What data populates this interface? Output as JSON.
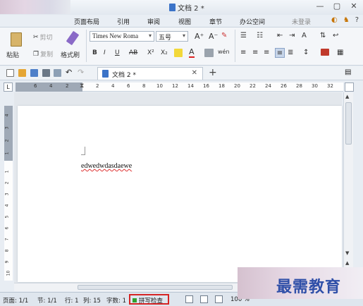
{
  "window": {
    "title": "文档 2 *",
    "controls": [
      "—",
      "▢",
      "✕"
    ]
  },
  "menu_tabs": [
    "页面布局",
    "引用",
    "审阅",
    "视图",
    "章节",
    "办公空间"
  ],
  "account": {
    "login_label": "未登录"
  },
  "ribbon": {
    "paste_label": "粘贴",
    "cut_label": "剪切",
    "copy_label": "复制",
    "format_painter_label": "格式刷",
    "font_name": "Times New Roma",
    "font_size": "五号",
    "bold": "B",
    "italic": "I",
    "underline": "U",
    "strike": "AB",
    "superscript": "X²",
    "subscript": "X₂"
  },
  "document_tab": {
    "label": "文档 2 *",
    "close": "✕",
    "new_tab": "+"
  },
  "ruler": {
    "corner": "L",
    "left_ticks": [
      "6",
      "4",
      "2"
    ],
    "right_ticks": [
      "2",
      "4",
      "6",
      "8",
      "10",
      "12",
      "14",
      "16",
      "18",
      "20",
      "22",
      "24",
      "26",
      "28",
      "30",
      "32"
    ],
    "vertical_ticks": [
      "4",
      "3",
      "2",
      "1",
      "1",
      "2",
      "3",
      "4",
      "5",
      "6",
      "7",
      "8",
      "9",
      "10"
    ]
  },
  "document": {
    "text": "edwedwdasdaewe"
  },
  "status_bar": {
    "page": "页面: 1/1",
    "section": "节: 1/1",
    "row": "行: 1",
    "column": "列: 15",
    "word_count": "字数: 1",
    "spell_check": "拼写检查",
    "zoom": "100 %"
  },
  "watermark": {
    "text": "最需教育"
  },
  "colors": {
    "accent": "#3b73c8",
    "spell_highlight": "#d62424",
    "status_bar": "#dfe6ee",
    "watermark_text": "#2f4fa8"
  }
}
